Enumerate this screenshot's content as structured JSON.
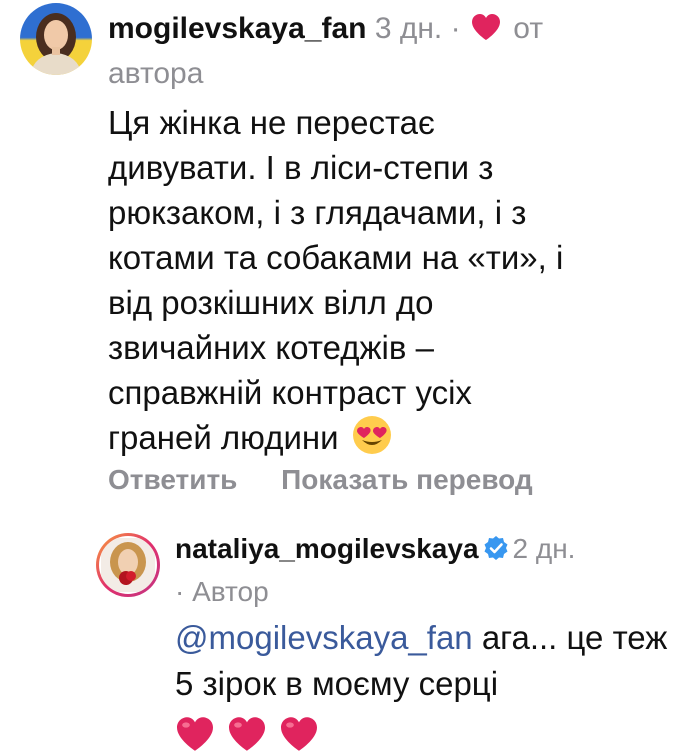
{
  "comment": {
    "username": "mogilevskaya_fan",
    "time": "3 дн.",
    "separator": "·",
    "liked_label_1": "от",
    "liked_label_2": "автора",
    "text": "Ця жінка не перестає\nдивувати. І в ліси-степи з\nрюкзаком, і з глядачами, і з\nкотами та собаками на «ти», і\nвід розкішних вілл до\nзвичайних котеджів –\nсправжній контраст усіх\nграней людини",
    "emoji": "heart-eyes-emoji",
    "actions": {
      "reply": "Ответить",
      "translate": "Показать перевод"
    }
  },
  "reply": {
    "username": "nataliya_mogilevskaya",
    "verified": true,
    "time": "2 дн.",
    "author_label": "· Автор",
    "mention": "@mogilevskaya_fan",
    "text": " ага... це теж 5 зірок в моєму серці",
    "hearts_count": 3
  },
  "colors": {
    "text": "#111111",
    "muted": "#8e8e93",
    "mention": "#3a5a9b",
    "heart": "#e0245e",
    "verified": "#3897f0"
  }
}
